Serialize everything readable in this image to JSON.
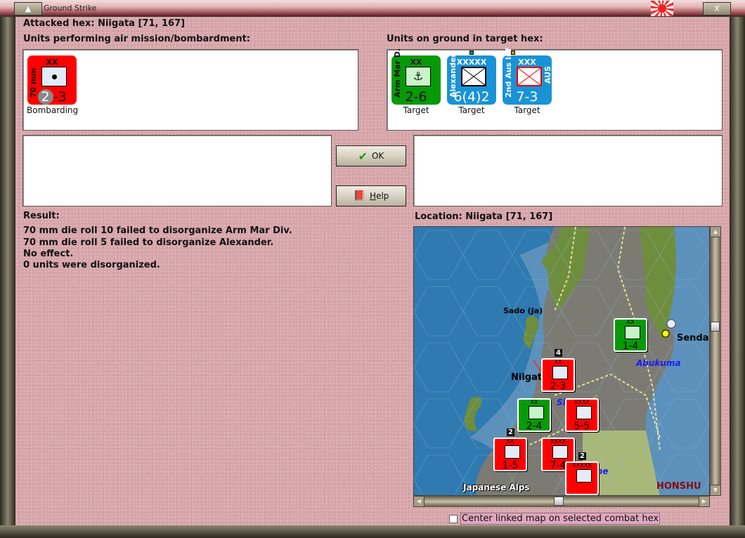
{
  "window": {
    "title": "Ground Strike",
    "minimize_icon": "triangle-up-icon",
    "close_label": "X"
  },
  "header": {
    "attacked_hex": "Attacked hex: Niigata  [71, 167]"
  },
  "air": {
    "label": "Units performing air mission/bombardment:",
    "units": [
      {
        "name": "70 mm",
        "size": "XX",
        "strength_a": "2",
        "strength_b": "-3",
        "status": "Bombarding",
        "color": "#ff0000"
      }
    ]
  },
  "ground": {
    "label": "Units on ground in target hex:",
    "units": [
      {
        "name": "Arm Mar D.",
        "size": "XX",
        "strength": "2-6",
        "status": "Target",
        "color": "#079a07"
      },
      {
        "name": "Alexander",
        "size": "XXXXX",
        "strength": "6(4)2",
        "status": "Target",
        "color": "#1a93d6",
        "dot": "#0a8a6a"
      },
      {
        "name": "2nd Aus Inf",
        "size": "XXX",
        "strength": "7-3",
        "status": "Target",
        "color": "#1a93d6",
        "dot": "#e09010",
        "nation": "AUS"
      }
    ]
  },
  "buttons": {
    "ok": "OK",
    "help": "Help",
    "help_accel": "H",
    "help_rest": "elp"
  },
  "result": {
    "label": "Result:",
    "lines": [
      "70 mm die roll 10 failed to disorganize Arm Mar Div.",
      "70 mm die roll 5 failed to disorganize Alexander.",
      "No effect.",
      "0 units were disorganized."
    ]
  },
  "location": {
    "label": "Location:  Niigata  [71, 167]"
  },
  "map": {
    "labels": {
      "sado": "Sado (Ja)",
      "niigata": "Niigat",
      "sendai": "Senda",
      "abukuma": "Abukuma",
      "tone": "Tone",
      "shinano": "Sl",
      "honshu": "HONSHU",
      "alps": "Japanese Alps"
    },
    "counters": [
      {
        "size": "XX",
        "strength": "1-4",
        "color": "#079a07",
        "stack": ""
      },
      {
        "size": "XX",
        "strength": "2-3",
        "color": "#ff0000",
        "stack": "4"
      },
      {
        "size": "XX",
        "strength": "2-4",
        "color": "#079a07",
        "stack": ""
      },
      {
        "size": "XXXX",
        "strength": "5-5",
        "color": "#ff0000",
        "stack": ""
      },
      {
        "size": "XX",
        "strength": "1-5",
        "color": "#ff0000",
        "stack": "2"
      },
      {
        "size": "XXXX",
        "strength": "7-4",
        "color": "#ff0000",
        "stack": ""
      },
      {
        "size": "XXXXX",
        "strength": "",
        "color": "#ff0000",
        "stack": "2"
      }
    ]
  },
  "options": {
    "center_map": "Center linked map on selected combat hex",
    "center_map_checked": false
  }
}
